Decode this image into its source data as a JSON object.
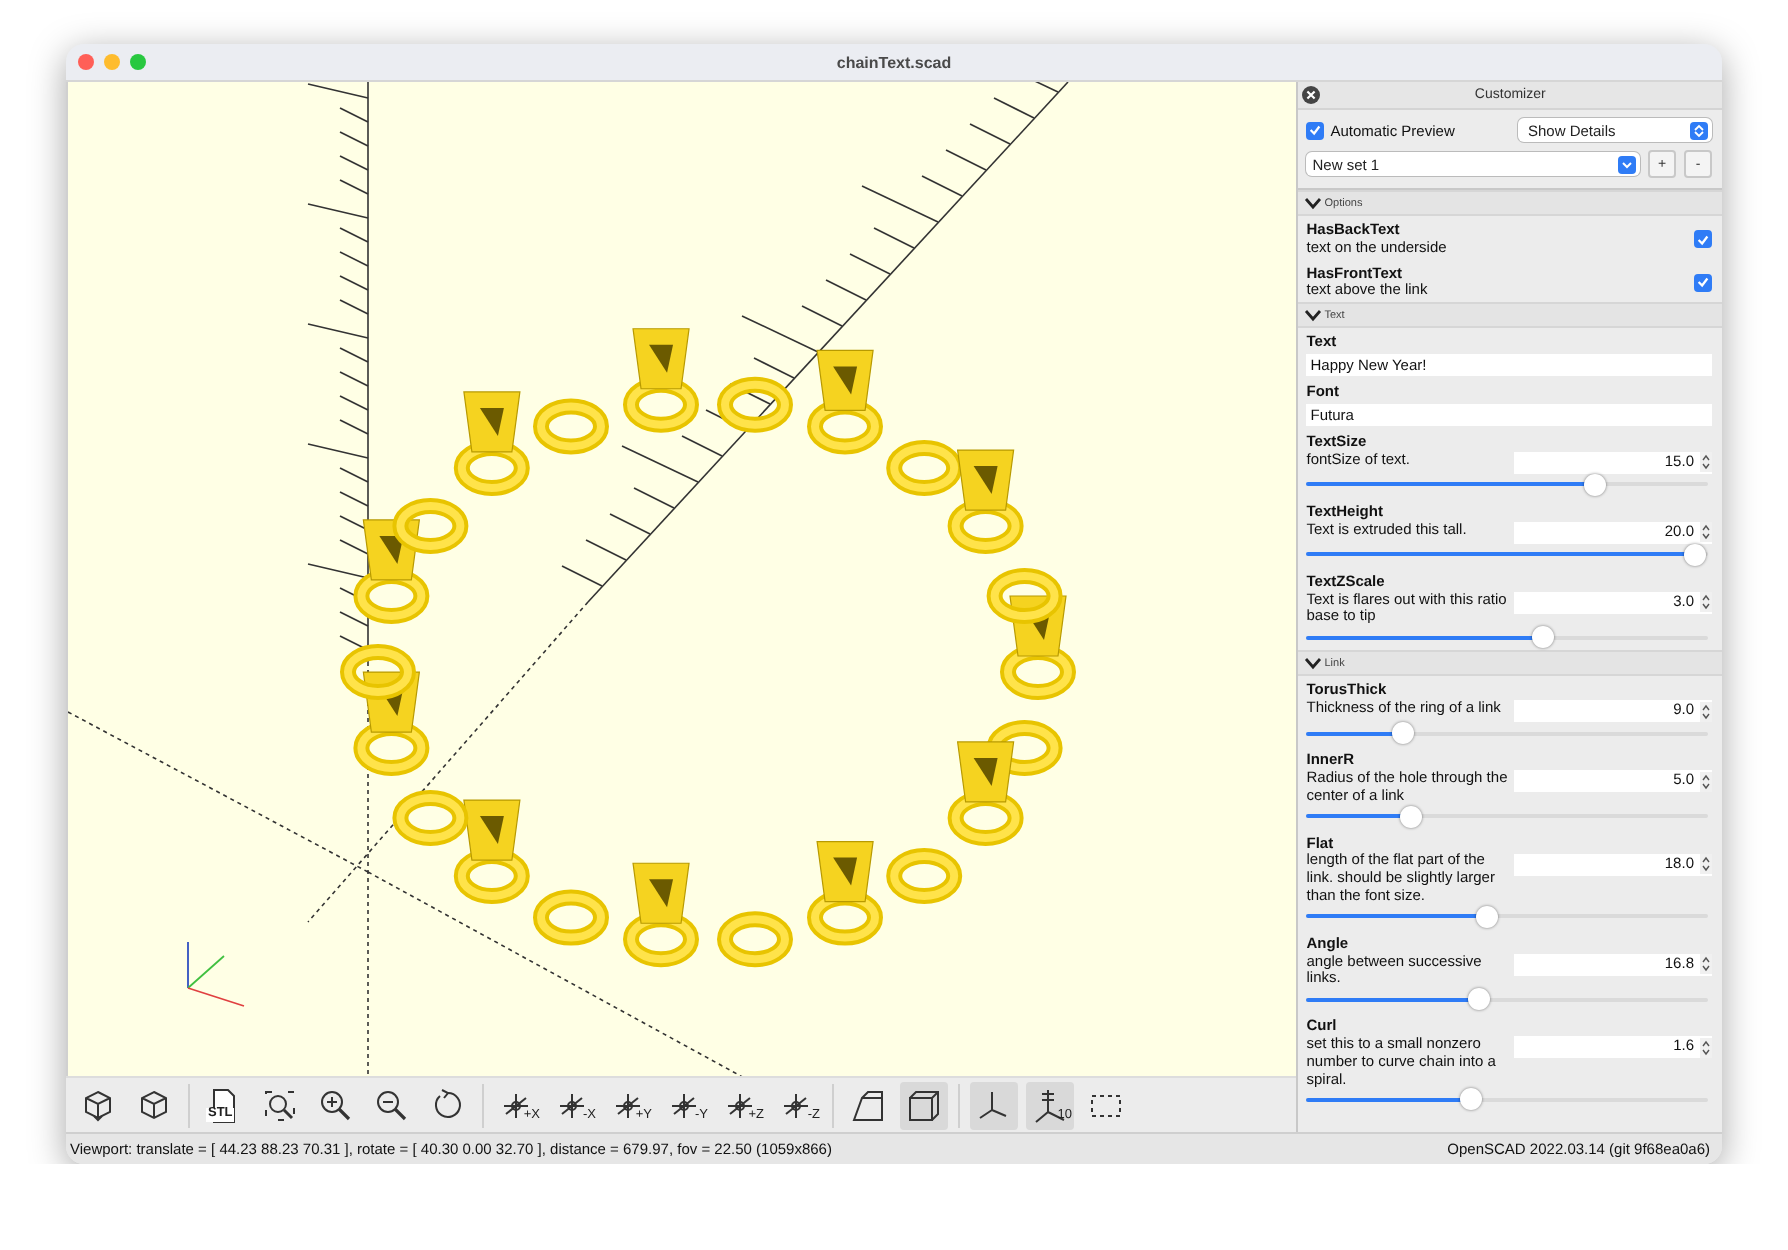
{
  "window": {
    "title": "chainText.scad"
  },
  "toolbar": [
    {
      "kind": "preview",
      "on": false
    },
    {
      "kind": "render",
      "on": false
    },
    {
      "kind": "export-stl",
      "label": "STL",
      "on": false
    },
    {
      "kind": "view-all",
      "on": false
    },
    {
      "kind": "zoom-in",
      "on": false
    },
    {
      "kind": "zoom-out",
      "on": false
    },
    {
      "kind": "reset-view",
      "on": false
    },
    {
      "kind": "axis-view",
      "label": "+X",
      "on": false
    },
    {
      "kind": "axis-view",
      "label": "-X",
      "on": false
    },
    {
      "kind": "axis-view",
      "label": "+Y",
      "on": false
    },
    {
      "kind": "axis-view",
      "label": "-Y",
      "on": false
    },
    {
      "kind": "axis-view",
      "label": "+Z",
      "on": false
    },
    {
      "kind": "axis-view",
      "label": "-Z",
      "on": false
    },
    {
      "kind": "perspective",
      "on": false
    },
    {
      "kind": "orthogonal",
      "on": true
    },
    {
      "kind": "axes",
      "on": true
    },
    {
      "kind": "scale-markers",
      "label": "10",
      "on": true
    },
    {
      "kind": "edges",
      "on": false
    }
  ],
  "status_bar": {
    "viewport": "Viewport: translate = [ 44.23 88.23 70.31 ], rotate = [ 40.30 0.00 32.70 ], distance = 679.97, fov = 22.50 (1059x866)",
    "version": "OpenSCAD 2022.03.14 (git 9f68ea0a6)"
  },
  "customizer": {
    "title": "Customizer",
    "automatic_preview": {
      "label": "Automatic Preview",
      "checked": true
    },
    "details": "Show Details",
    "preset": "New set 1",
    "buttons": [
      "+",
      "-"
    ],
    "groups": [
      {
        "title": "Options",
        "expanded": true,
        "params": [
          {
            "kind": "checkbox",
            "name": "HasBackText",
            "description": "text on the underside",
            "checked": true
          },
          {
            "kind": "checkbox",
            "name": "HasFrontText",
            "description": "text above the link",
            "checked": true
          }
        ]
      },
      {
        "title": "Text",
        "expanded": true,
        "params": [
          {
            "kind": "text",
            "name": "Text",
            "value": "Happy New Year!"
          },
          {
            "kind": "text",
            "name": "Font",
            "value": "Futura"
          },
          {
            "kind": "slider",
            "name": "TextSize",
            "description": "fontSize of text.",
            "value": "15.0",
            "level": 0.72
          },
          {
            "kind": "slider",
            "name": "TextHeight",
            "description": "Text is extruded this tall.",
            "value": "20.0",
            "level": 0.97
          },
          {
            "kind": "slider",
            "name": "TextZScale",
            "description": "Text is flares out with this ratio base to tip",
            "value": "3.0",
            "level": 0.59
          }
        ]
      },
      {
        "title": "Link",
        "expanded": true,
        "params": [
          {
            "kind": "slider",
            "name": "TorusThick",
            "description": "Thickness of the ring of a link",
            "value": "9.0",
            "level": 0.24
          },
          {
            "kind": "slider",
            "name": "InnerR",
            "description": "Radius of the hole through the center of a link",
            "value": "5.0",
            "level": 0.26
          },
          {
            "kind": "slider",
            "name": "Flat",
            "description": "length of the flat part of the link. should be slightly larger than the font size.",
            "value": "18.0",
            "level": 0.45
          },
          {
            "kind": "slider",
            "name": "Angle",
            "description": "angle between successive links.",
            "value": "16.8",
            "level": 0.43
          },
          {
            "kind": "slider",
            "name": "Curl",
            "description": "set this to a small nonzero number to curve chain into a spiral.",
            "value": "1.6",
            "level": 0.41
          }
        ]
      }
    ]
  }
}
